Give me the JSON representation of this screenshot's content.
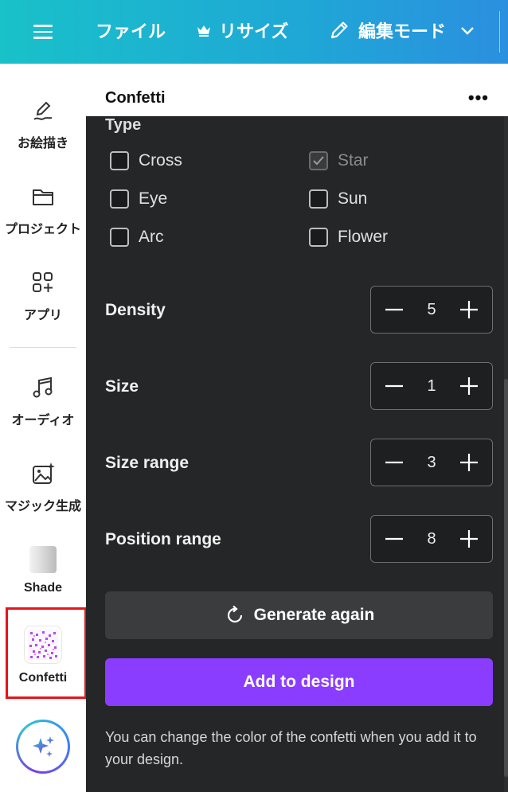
{
  "topbar": {
    "menu_icon": "hamburger-icon",
    "file_label": "ファイル",
    "resize_label": "リサイズ",
    "edit_mode_label": "編集モード"
  },
  "sidebar": {
    "items": [
      {
        "label": "お絵描き",
        "icon": "draw-icon"
      },
      {
        "label": "プロジェクト",
        "icon": "folder-icon"
      },
      {
        "label": "アプリ",
        "icon": "apps-icon"
      },
      {
        "label": "オーディオ",
        "icon": "music-note-icon"
      },
      {
        "label": "マジック生成",
        "icon": "magic-image-icon"
      },
      {
        "label": "Shade",
        "icon": "shade-app-icon"
      },
      {
        "label": "Confetti",
        "icon": "confetti-app-icon"
      }
    ]
  },
  "panel": {
    "title": "Confetti",
    "type_label": "Type",
    "types": [
      {
        "label": "Cross",
        "checked": false
      },
      {
        "label": "Star",
        "checked": true
      },
      {
        "label": "Eye",
        "checked": false
      },
      {
        "label": "Sun",
        "checked": false
      },
      {
        "label": "Arc",
        "checked": false
      },
      {
        "label": "Flower",
        "checked": false
      }
    ],
    "steppers": [
      {
        "label": "Density",
        "value": "5"
      },
      {
        "label": "Size",
        "value": "1"
      },
      {
        "label": "Size range",
        "value": "3"
      },
      {
        "label": "Position range",
        "value": "8"
      }
    ],
    "generate_label": "Generate again",
    "add_label": "Add to design",
    "note": "You can change the color of the confetti when you add it to your design."
  },
  "colors": {
    "topbar_start": "#19c1c9",
    "topbar_end": "#2b8fe0",
    "panel_bg": "#252627",
    "primary": "#8b3dff",
    "highlight": "#e4161c"
  }
}
